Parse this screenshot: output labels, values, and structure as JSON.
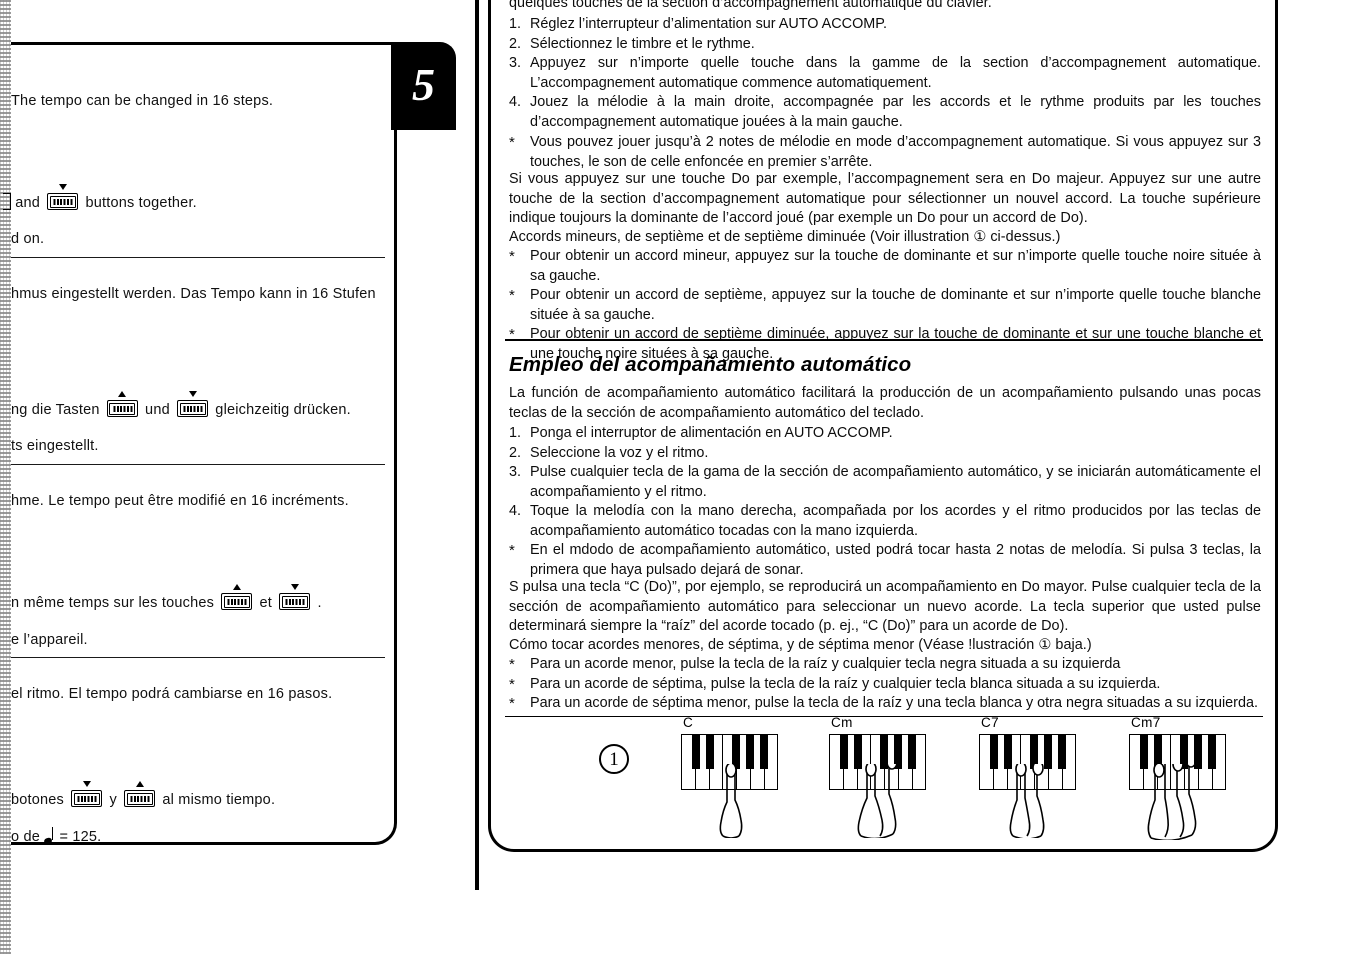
{
  "page_tab": {
    "number": "5"
  },
  "left_page": {
    "note": "Left page is cut off at the binding; only the right-hand fragments of each line are visible.",
    "lines": [
      {
        "text": "The tempo can be changed in 16 steps."
      },
      {
        "pre": "",
        "mid": " and ",
        "post": " buttons  together."
      },
      {
        "text": "d on."
      },
      {
        "text": "hmus eingestellt werden. Das Tempo kann in 16 Stufen"
      },
      {
        "pre": "ng die Tasten ",
        "mid": " und ",
        "post": " gleichzeitig drücken."
      },
      {
        "text": "ts eingestellt."
      },
      {
        "text": "hme. Le tempo peut être modifié en 16 incréments."
      },
      {
        "pre": "n même temps sur les touches ",
        "mid": " et ",
        "post": " ."
      },
      {
        "text": "e l’appareil."
      },
      {
        "text": "el ritmo.  El tempo podrá cambiarse en 16 pasos."
      },
      {
        "pre": "botones ",
        "mid": " y ",
        "post": " al mismo tiempo."
      },
      {
        "pre2": "o de ",
        "post2": " = 125."
      }
    ]
  },
  "right_page": {
    "french": {
      "intro_tail": "quelques touches de la section d’accompagnement automatique du clavier.",
      "steps": [
        {
          "num": "1.",
          "text": "Réglez l’interrupteur d’alimentation sur AUTO ACCOMP."
        },
        {
          "num": "2.",
          "text": "Sélectionnez le timbre et le rythme."
        },
        {
          "num": "3.",
          "text": "Appuyez sur n’importe quelle touche dans la gamme de la section d’accompagnement automatique. L’accompagnement automatique commence automatiquement."
        },
        {
          "num": "4.",
          "text": "Jouez la mélodie à la main droite, accompagnée par les accords et le rythme produits par les touches d’accompagnement automatique jouées à la main gauche."
        }
      ],
      "note": {
        "num": "*",
        "text": "Vous pouvez jouer jusqu’à 2 notes de mélodie en mode d’accompagnement automatique. Si vous appuyez sur 3 touches, le son de celle enfoncée en premier s’arrête."
      },
      "body": "Si vous appuyez sur une touche Do par exemple, l’accompagnement sera en Do majeur. Appuyez sur une autre touche de la section d’accompagnement automatique pour sélectionner un nouvel accord. La touche supérieure indique toujours la dominante de l’accord joué (par exemple un Do pour un accord de Do).",
      "chords_lead": "Accords mineurs, de septième et de septième diminuée  (Voir illustration ① ci-dessus.)",
      "bullets": [
        {
          "mark": "*",
          "text": "Pour obtenir un accord mineur, appuyez sur la touche de dominante et sur n’importe quelle touche noire située à sa gauche."
        },
        {
          "mark": "*",
          "text": "Pour obtenir un accord de septième, appuyez sur la touche de dominante et sur n’importe quelle touche blanche située à sa gauche."
        },
        {
          "mark": "*",
          "text": "Pour obtenir un accord de septième diminuée, appuyez sur la touche de dominante et sur une touche blanche et une touche noire situées à sa gauche."
        }
      ]
    },
    "spanish": {
      "title": "Empleo del acompañamiento automático",
      "intro": "La función de acompañamiento automático facilitará la producción de un acompañamiento pulsando unas pocas teclas de la sección de acompañamiento automático del teclado.",
      "steps": [
        {
          "num": "1.",
          "text": "Ponga el interruptor de alimentación en AUTO ACCOMP."
        },
        {
          "num": "2.",
          "text": "Seleccione la voz y el ritmo."
        },
        {
          "num": "3.",
          "text": "Pulse cualquier tecla de la gama de la sección de acompañamiento automático, y se iniciarán automáticamente el acompañamiento y el ritmo."
        },
        {
          "num": "4.",
          "text": "Toque la melodía con la mano derecha, acompañada por los acordes y el ritmo producidos por las teclas de acompañamiento automático tocadas con la mano izquierda."
        }
      ],
      "note": {
        "num": "*",
        "text": "En el mdodo de acompañamiento automático, usted podrá tocar hasta 2 notas de melodía.  Si pulsa 3 teclas, la primera que haya pulsado dejará de sonar."
      },
      "body": "S pulsa una tecla “C (Do)”, por ejemplo, se reproducirá un acompañamiento en Do mayor.  Pulse cualquier tecla de la sección de acompañamiento automático para seleccionar un nuevo acorde.  La tecla superior que usted pulse determinará siempre la “raíz” del acorde tocado (p. ej., “C (Do)” para un acorde de Do).",
      "chords_lead": "Cómo tocar acordes menores, de séptima, y de séptima menor (Véase !lustración ① baja.)",
      "bullets": [
        {
          "mark": "*",
          "text": "Para un acorde menor, pulse la tecla de la raíz y cualquier tecla negra situada a su izquierda"
        },
        {
          "mark": "*",
          "text": "Para un acorde de séptima, pulse la tecla de la raíz y cualquier tecla blanca situada a su izquierda."
        },
        {
          "mark": "*",
          "text": "Para un acorde de séptima menor, pulse la tecla de la raíz y una tecla blanca y otra negra situadas a su izquierda."
        }
      ]
    },
    "figure": {
      "index": "1",
      "chords": [
        {
          "label": "C"
        },
        {
          "label": "Cm"
        },
        {
          "label": "C7"
        },
        {
          "label": "Cm7"
        }
      ]
    }
  }
}
